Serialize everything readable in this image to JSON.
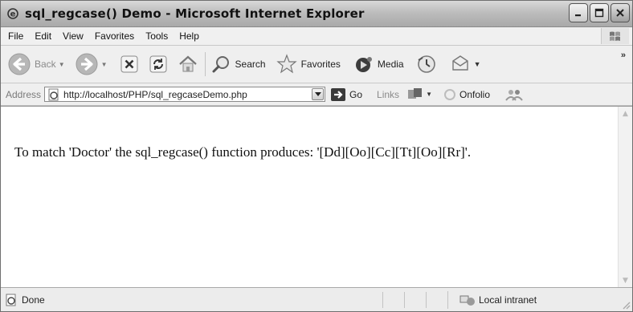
{
  "window": {
    "title": "sql_regcase() Demo - Microsoft Internet Explorer"
  },
  "menu": [
    "File",
    "Edit",
    "View",
    "Favorites",
    "Tools",
    "Help"
  ],
  "toolbar": {
    "back_label": "Back",
    "search_label": "Search",
    "favorites_label": "Favorites",
    "media_label": "Media",
    "overflow": "»"
  },
  "address": {
    "label": "Address",
    "url": "http://localhost/PHP/sql_regcaseDemo.php",
    "go_label": "Go",
    "links_label": "Links",
    "onfolio_label": "Onfolio"
  },
  "page": {
    "text": "To match 'Doctor' the sql_regcase() function produces: '[Dd][Oo][Cc][Tt][Oo][Rr]'."
  },
  "status": {
    "text": "Done",
    "zone": "Local intranet"
  }
}
